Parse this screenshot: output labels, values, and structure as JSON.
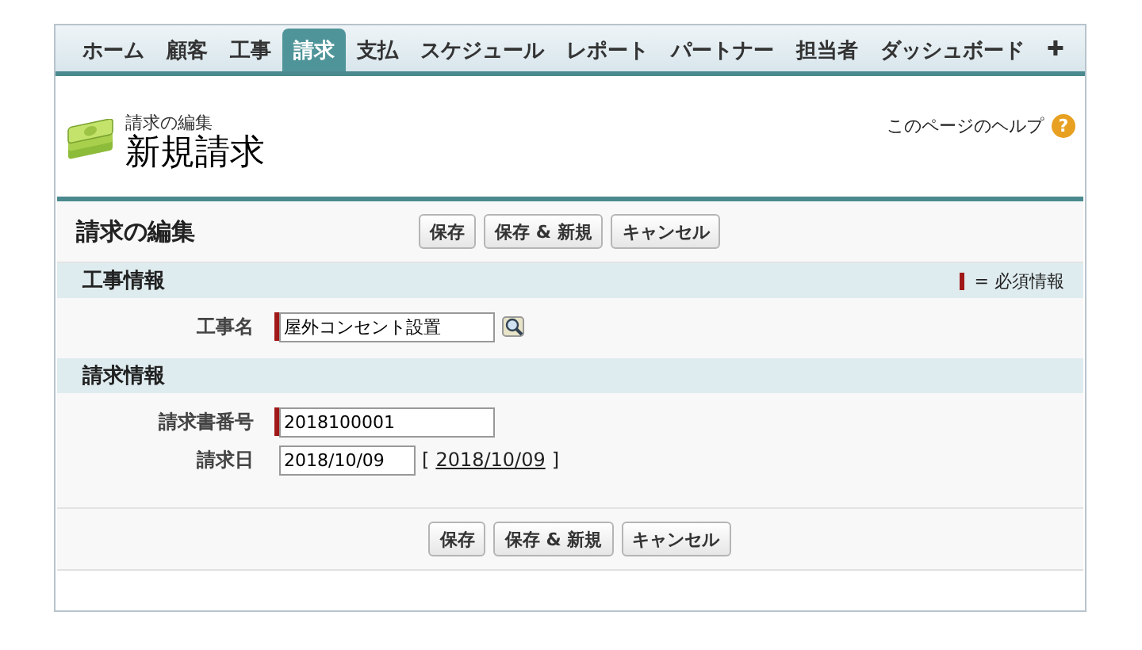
{
  "tabs": [
    {
      "label": "ホーム",
      "selected": false
    },
    {
      "label": "顧客",
      "selected": false
    },
    {
      "label": "工事",
      "selected": false
    },
    {
      "label": "請求",
      "selected": true
    },
    {
      "label": "支払",
      "selected": false
    },
    {
      "label": "スケジュール",
      "selected": false
    },
    {
      "label": "レポート",
      "selected": false
    },
    {
      "label": "パートナー",
      "selected": false
    },
    {
      "label": "担当者",
      "selected": false
    },
    {
      "label": "ダッシュボード",
      "selected": false
    },
    {
      "label": "✚",
      "selected": false
    }
  ],
  "header": {
    "subtitle": "請求の編集",
    "title": "新規請求",
    "help_link": "このページのヘルプ",
    "help_icon": "?"
  },
  "form": {
    "title": "請求の編集",
    "top_buttons": [
      "保存",
      "保存 & 新規",
      "キャンセル"
    ],
    "required_legend": "= 必須情報",
    "sections": [
      {
        "title": "工事情報",
        "fields": [
          {
            "label": "工事名",
            "value": "屋外コンセント設置",
            "required": true,
            "lookup": true
          }
        ]
      },
      {
        "title": "請求情報",
        "fields": [
          {
            "label": "請求書番号",
            "value": "2018100001",
            "required": true,
            "lookup": false
          },
          {
            "label": "請求日",
            "value": "2018/10/09",
            "required": false,
            "lookup": false,
            "date_open": "[",
            "date_link": "2018/10/09",
            "date_close": "]"
          }
        ]
      }
    ],
    "bottom_buttons": [
      "保存",
      "保存 & 新規",
      "キャンセル"
    ]
  }
}
